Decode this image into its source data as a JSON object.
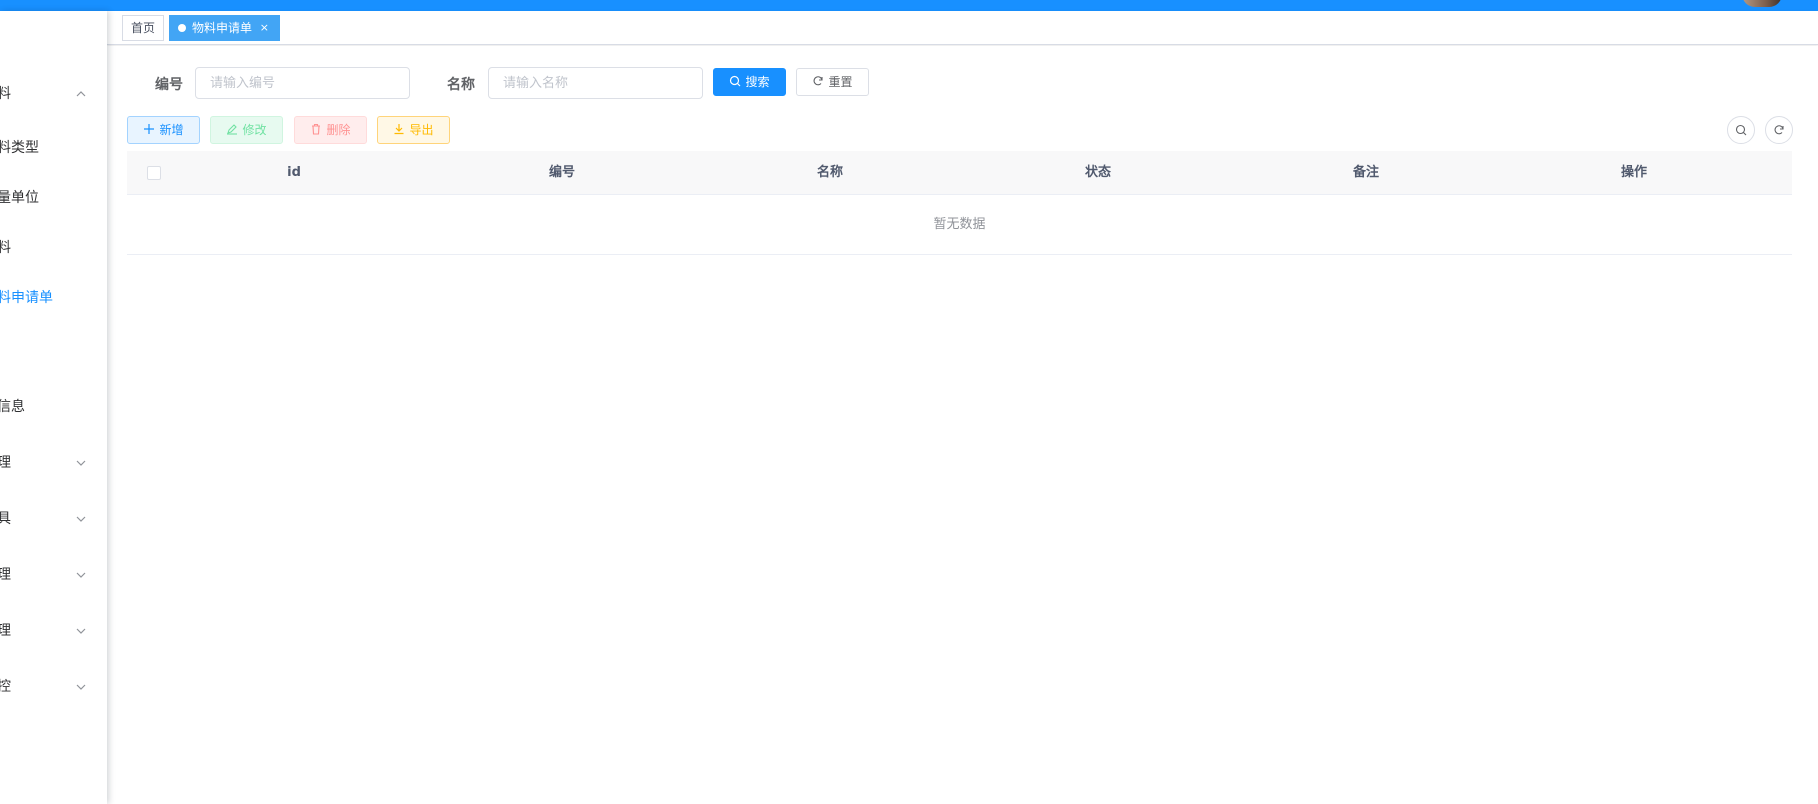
{
  "sidebar": {
    "items": [
      {
        "label": "料",
        "active": false,
        "has_arrow": true,
        "arrow": "chevron-up-icon"
      },
      {
        "label": "料类型",
        "active": false,
        "has_arrow": false
      },
      {
        "label": "量单位",
        "active": false,
        "has_arrow": false
      },
      {
        "label": "料",
        "active": false,
        "has_arrow": false
      },
      {
        "label": "料申请单",
        "active": true,
        "has_arrow": false
      },
      {
        "label": "信息",
        "active": false,
        "has_arrow": false
      },
      {
        "label": "理",
        "active": false,
        "has_arrow": true,
        "arrow": "chevron-down-icon"
      },
      {
        "label": "具",
        "active": false,
        "has_arrow": true,
        "arrow": "chevron-down-icon"
      },
      {
        "label": "理",
        "active": false,
        "has_arrow": true,
        "arrow": "chevron-down-icon"
      },
      {
        "label": "理",
        "active": false,
        "has_arrow": true,
        "arrow": "chevron-down-icon"
      },
      {
        "label": "控",
        "active": false,
        "has_arrow": true,
        "arrow": "chevron-down-icon"
      }
    ]
  },
  "tags": {
    "home": "首页",
    "active": "物料申请单",
    "close": "×"
  },
  "search": {
    "code_label": "编号",
    "code_placeholder": "请输入编号",
    "name_label": "名称",
    "name_placeholder": "请输入名称",
    "search_button": "搜索",
    "reset_button": "重置"
  },
  "toolbar": {
    "add": "新增",
    "edit": "修改",
    "delete": "删除",
    "export": "导出"
  },
  "table": {
    "columns": [
      "id",
      "编号",
      "名称",
      "状态",
      "备注",
      "操作"
    ],
    "empty_text": "暂无数据"
  },
  "colors": {
    "primary": "#1890ff",
    "active_tag": "#42a5f5",
    "success": "#71e2a3",
    "danger": "#ff9292",
    "warning": "#ffba00"
  }
}
